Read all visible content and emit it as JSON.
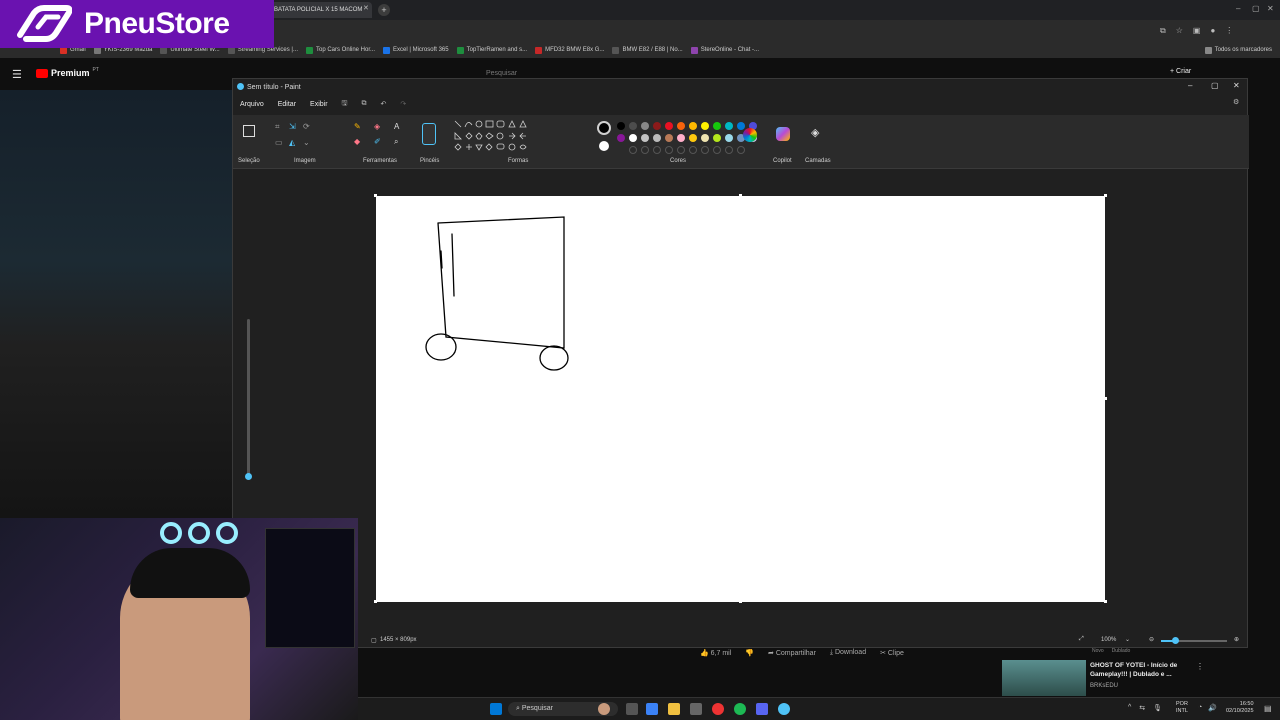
{
  "logo": {
    "text": "PneuStore"
  },
  "browser": {
    "active_tab": "BATATA POLICIAL X 15 MACOM",
    "bookmarks": [
      "Gmail",
      "YKIS-2369 Mazda",
      "Ultimate Steel W...",
      "Streaming Services |...",
      "Top Cars Online Hor...",
      "Excel | Microsoft 365",
      "TopTierRamen and s...",
      "MFD32 BMW E8x G...",
      "BMW E82 / E88 | No...",
      "StereOnline - Chat -..."
    ],
    "all_bookmarks": "Todos os marcadores"
  },
  "youtube": {
    "premium_label": "Premium",
    "region": "PT",
    "search_placeholder": "Pesquisar",
    "create_label": "Criar",
    "likes": "6,7 mil",
    "share": "Compartilhar",
    "download": "Download",
    "clip": "Clipe",
    "rec_title": "GHOST OF YOTEI - Início de Gameplay!!! | Dublado e ...",
    "rec_channel": "BRKsEDU",
    "rec_tag": "Novo",
    "rec_tag2": "Dublado"
  },
  "paint": {
    "title": "Sem título - Paint",
    "menu": [
      "Arquivo",
      "Editar",
      "Exibir"
    ],
    "groups": {
      "selection": "Seleção",
      "image": "Imagem",
      "tools": "Ferramentas",
      "brushes": "Pincéis",
      "shapes": "Formas",
      "colors": "Cores",
      "copilot": "Copilot",
      "layers": "Camadas"
    },
    "canvas_size": "1455 × 809px",
    "zoom": "100%",
    "palette": [
      "#000000",
      "#4d4d4d",
      "#888888",
      "#8b1a1a",
      "#e81123",
      "#f7630c",
      "#ffb900",
      "#fff100",
      "#16c60c",
      "#00b7c3",
      "#0078d7",
      "#4f4bd9",
      "#881798",
      "#ffffff",
      "#c3c3c3",
      "#bbbbbb",
      "#b97a57",
      "#ffaec9",
      "#ffc90e",
      "#efe4b0",
      "#b5e61d",
      "#99d9ea",
      "#7092be",
      "#c8bfe7"
    ]
  },
  "taskbar": {
    "search": "Pesquisar",
    "lang1": "POR",
    "lang2": "INTL",
    "time": "16:50",
    "date": "02/10/2025"
  }
}
